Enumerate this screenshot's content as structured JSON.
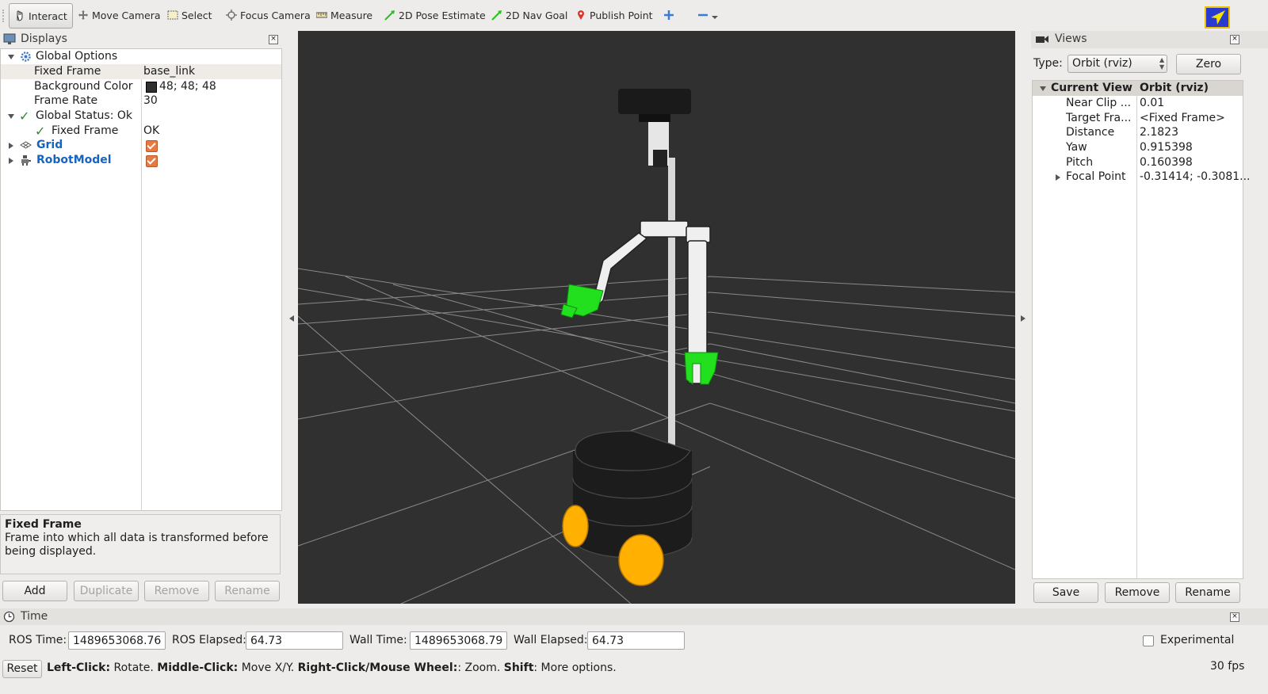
{
  "toolbar": {
    "tools": [
      {
        "label": "Interact",
        "icon": "hand-icon"
      },
      {
        "label": "Move Camera",
        "icon": "move-camera-icon"
      },
      {
        "label": "Select",
        "icon": "select-icon"
      },
      {
        "label": "Focus Camera",
        "icon": "focus-camera-icon"
      },
      {
        "label": "Measure",
        "icon": "ruler-icon"
      },
      {
        "label": "2D Pose Estimate",
        "icon": "green-arrow-icon"
      },
      {
        "label": "2D Nav Goal",
        "icon": "green-arrow-icon"
      },
      {
        "label": "Publish Point",
        "icon": "map-pin-icon"
      }
    ]
  },
  "displays": {
    "title": "Displays",
    "rows": {
      "global_options": "Global Options",
      "fixed_frame_label": "Fixed Frame",
      "fixed_frame_value": "base_link",
      "background_color_label": "Background Color",
      "background_color_value": "48; 48; 48",
      "frame_rate_label": "Frame Rate",
      "frame_rate_value": "30",
      "global_status": "Global Status: Ok",
      "status_fixed_frame_label": "Fixed Frame",
      "status_fixed_frame_value": "OK",
      "grid": "Grid",
      "robot_model": "RobotModel"
    },
    "help_title": "Fixed Frame",
    "help_text": "Frame into which all data is transformed before being displayed.",
    "buttons": {
      "add": "Add",
      "duplicate": "Duplicate",
      "remove": "Remove",
      "rename": "Rename"
    }
  },
  "views": {
    "title": "Views",
    "type_label": "Type:",
    "type_value": "Orbit (rviz)",
    "zero_button": "Zero",
    "header_name": "Current View",
    "header_value": "Orbit (rviz)",
    "properties": [
      {
        "name": "Near Clip ...",
        "value": "0.01"
      },
      {
        "name": "Target Fra...",
        "value": "<Fixed Frame>"
      },
      {
        "name": "Distance",
        "value": "2.1823"
      },
      {
        "name": "Yaw",
        "value": "0.915398"
      },
      {
        "name": "Pitch",
        "value": "0.160398"
      },
      {
        "name": "Focal Point",
        "value": "-0.31414; -0.3081..."
      }
    ],
    "buttons": {
      "save": "Save",
      "remove": "Remove",
      "rename": "Rename"
    }
  },
  "time": {
    "title": "Time",
    "ros_time_label": "ROS Time:",
    "ros_time_value": "1489653068.76",
    "ros_elapsed_label": "ROS Elapsed:",
    "ros_elapsed_value": "64.73",
    "wall_time_label": "Wall Time:",
    "wall_time_value": "1489653068.79",
    "wall_elapsed_label": "Wall Elapsed:",
    "wall_elapsed_value": "64.73",
    "experimental_label": "Experimental"
  },
  "status_bar": {
    "reset_button": "Reset",
    "hint_parts": [
      {
        "bold": "Left-Click:",
        "text": " Rotate. "
      },
      {
        "bold": "Middle-Click:",
        "text": " Move X/Y. "
      },
      {
        "bold": "Right-Click/Mouse Wheel:",
        "text": ": Zoom. "
      },
      {
        "bold": "Shift",
        "text": ": More options."
      }
    ],
    "fps": "30 fps"
  },
  "colors": {
    "viewport_bg": "#303030",
    "grid_line": "#a0a0a0",
    "gripper": "#22e01e",
    "wheel": "#ffb000",
    "link_blue": "#1565c0",
    "checkbox": "#e8793f",
    "tree_header": "#d9d6d2"
  }
}
